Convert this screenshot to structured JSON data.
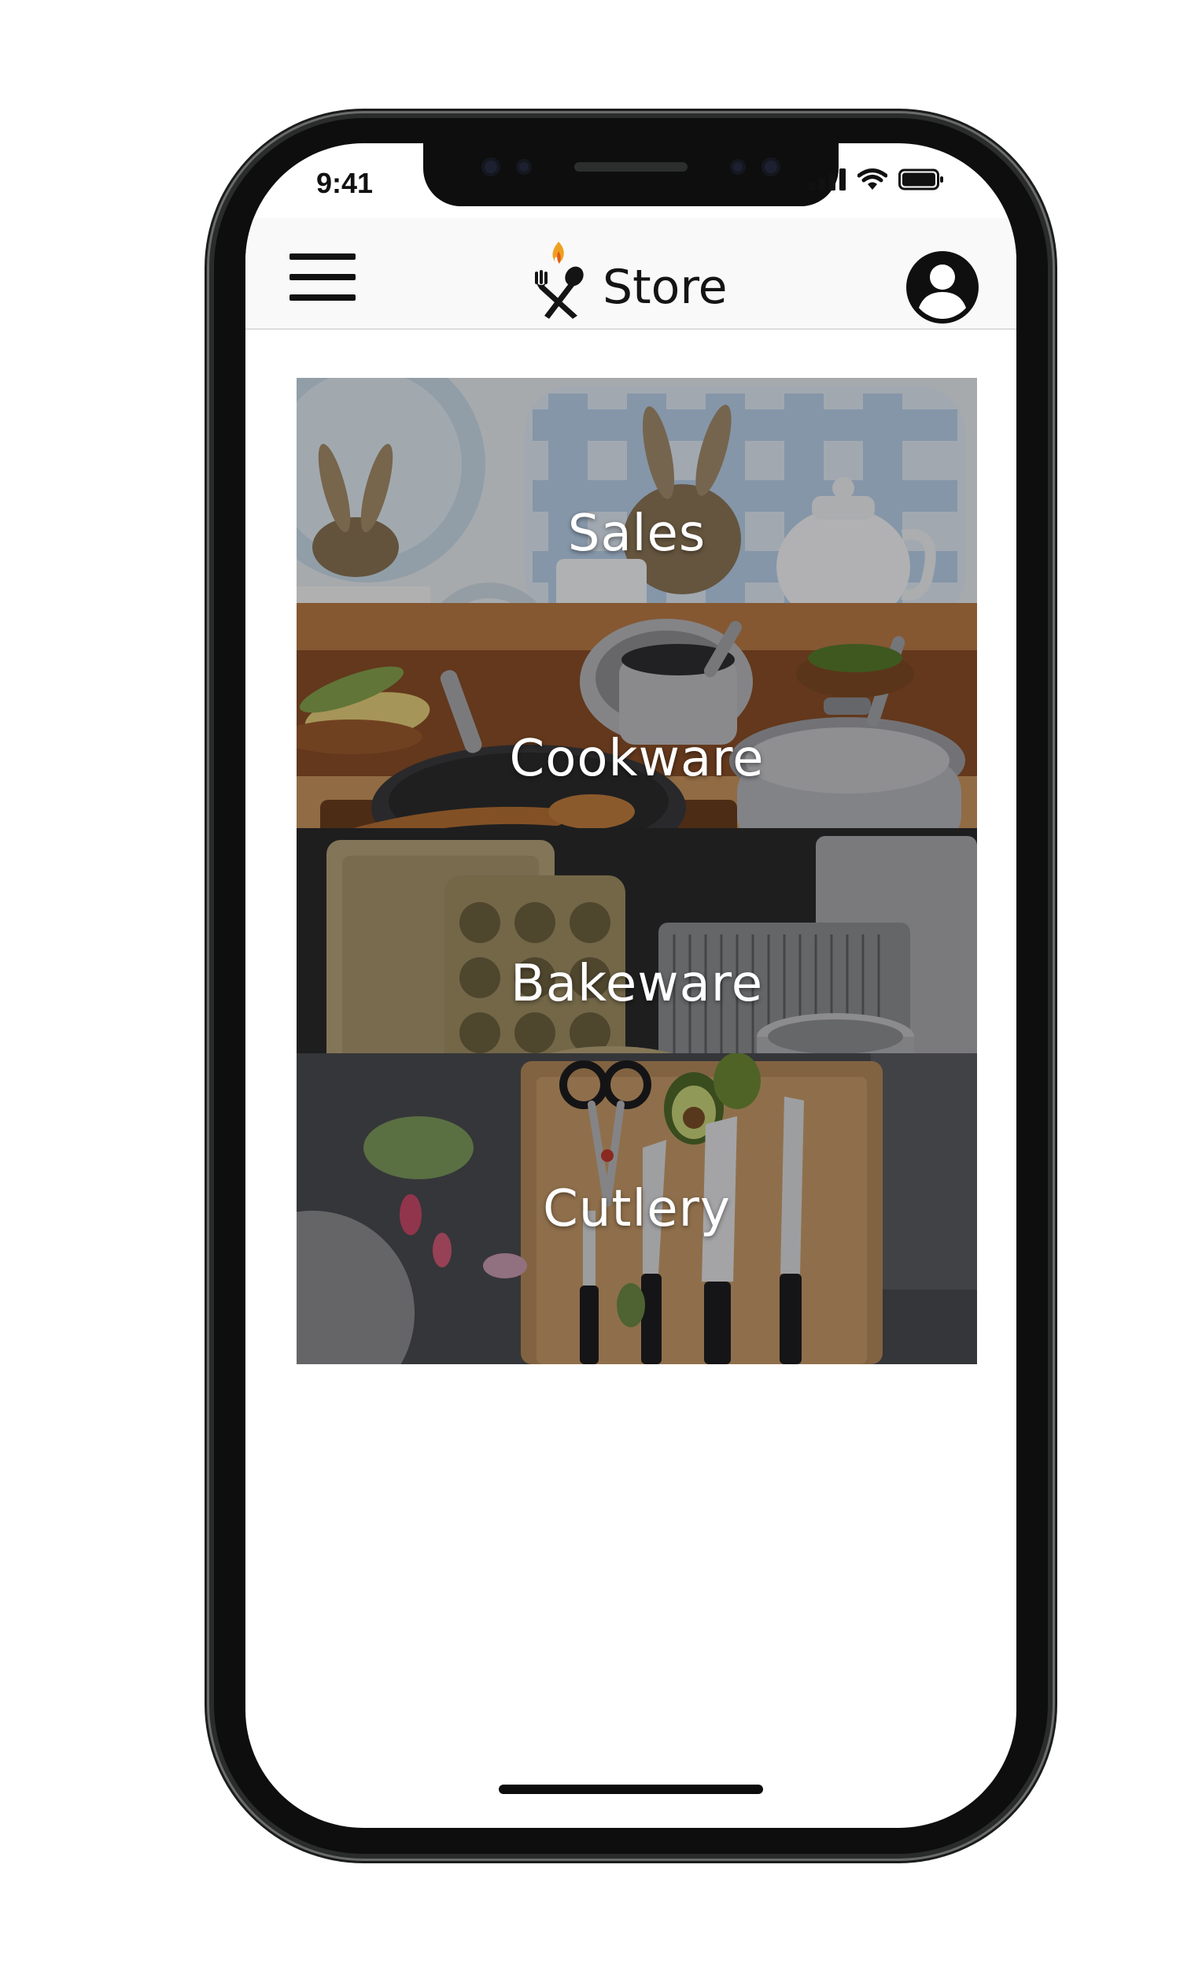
{
  "status_bar": {
    "time": "9:41",
    "icons": [
      "signal-icon",
      "wifi-icon",
      "battery-icon"
    ]
  },
  "header": {
    "menu_icon": "hamburger-menu-icon",
    "logo_icon": "fork-spoon-flame-icon",
    "title": "Store",
    "account_icon": "user-account-icon"
  },
  "categories": [
    {
      "label": "Sales"
    },
    {
      "label": "Cookware"
    },
    {
      "label": "Bakeware"
    },
    {
      "label": "Cutlery"
    }
  ],
  "colors": {
    "text_dark": "#141414",
    "header_bg": "#f9f9f9",
    "logo_flame": "#f0a020",
    "card_label": "#ffffff"
  }
}
